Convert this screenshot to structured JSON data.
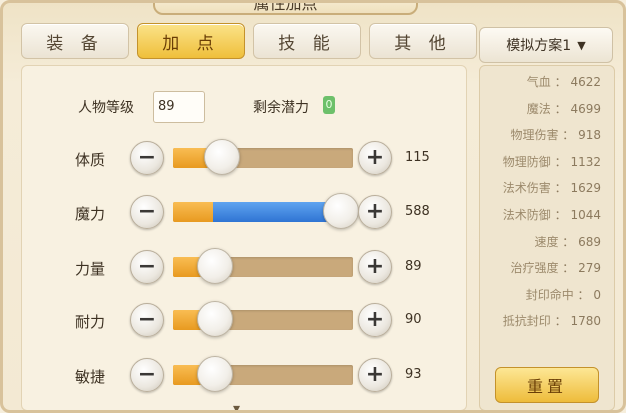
{
  "window": {
    "title": "属性加点"
  },
  "tabs": [
    {
      "label": "装 备",
      "active": false
    },
    {
      "label": "加 点",
      "active": true
    },
    {
      "label": "技 能",
      "active": false
    },
    {
      "label": "其 他",
      "active": false
    }
  ],
  "level": {
    "label": "人物等级",
    "value": "89"
  },
  "potential": {
    "label": "剩余潜力",
    "value": "0"
  },
  "attributes": [
    {
      "label": "体质",
      "value": "115",
      "level": 0.16,
      "fill_color": "orange"
    },
    {
      "label": "魔力",
      "value": "588",
      "level": 0.98,
      "fill_color": "blue"
    },
    {
      "label": "力量",
      "value": "89",
      "level": 0.12,
      "fill_color": "orange"
    },
    {
      "label": "耐力",
      "value": "90",
      "level": 0.12,
      "fill_color": "orange"
    },
    {
      "label": "敏捷",
      "value": "93",
      "level": 0.12,
      "fill_color": "orange"
    }
  ],
  "controls": {
    "minus": "−",
    "plus": "+"
  },
  "plan": {
    "label": "模拟方案1"
  },
  "stats": [
    {
      "label": "气血",
      "value": "4622"
    },
    {
      "label": "魔法",
      "value": "4699"
    },
    {
      "label": "物理伤害",
      "value": "918"
    },
    {
      "label": "物理防御",
      "value": "1132"
    },
    {
      "label": "法术伤害",
      "value": "1629"
    },
    {
      "label": "法术防御",
      "value": "1044"
    },
    {
      "label": "速度",
      "value": "689"
    },
    {
      "label": "治疗强度",
      "value": "279"
    },
    {
      "label": "封印命中",
      "value": "0"
    },
    {
      "label": "抵抗封印",
      "value": "1780"
    }
  ],
  "reset": {
    "label": "重置"
  },
  "colors": {
    "accent_gold": "#efbf3b",
    "bar_orange": "#e89a20",
    "bar_blue": "#2f74d3",
    "potential_green": "#6dc06a"
  }
}
